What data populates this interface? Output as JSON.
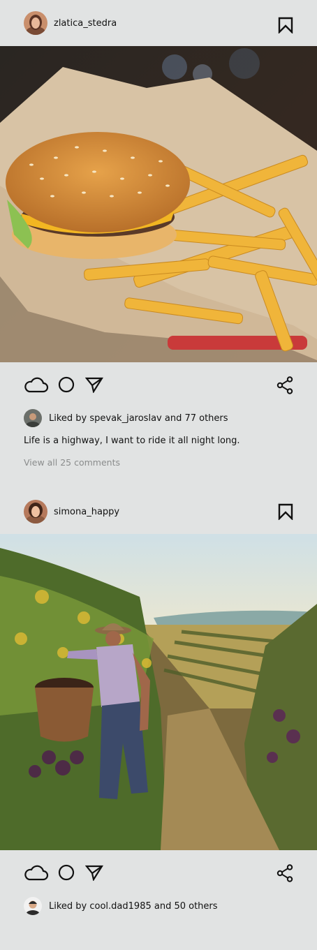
{
  "posts": [
    {
      "username": "zlatica_stedra",
      "liked_by_text": "Liked by spevak_jaroslav and 77 others",
      "caption": "Life is a highway, I want to ride it all night long.",
      "comments_link": "View all 25 comments",
      "image_subject": "burger-and-fries"
    },
    {
      "username": "simona_happy",
      "liked_by_text": "Liked by cool.dad1985 and 50 others",
      "image_subject": "vineyard-painting"
    }
  ],
  "icons": {
    "like": "cloud-icon",
    "comment": "circle-icon",
    "share": "send-icon",
    "network": "share-icon",
    "bookmark": "bookmark-icon"
  }
}
